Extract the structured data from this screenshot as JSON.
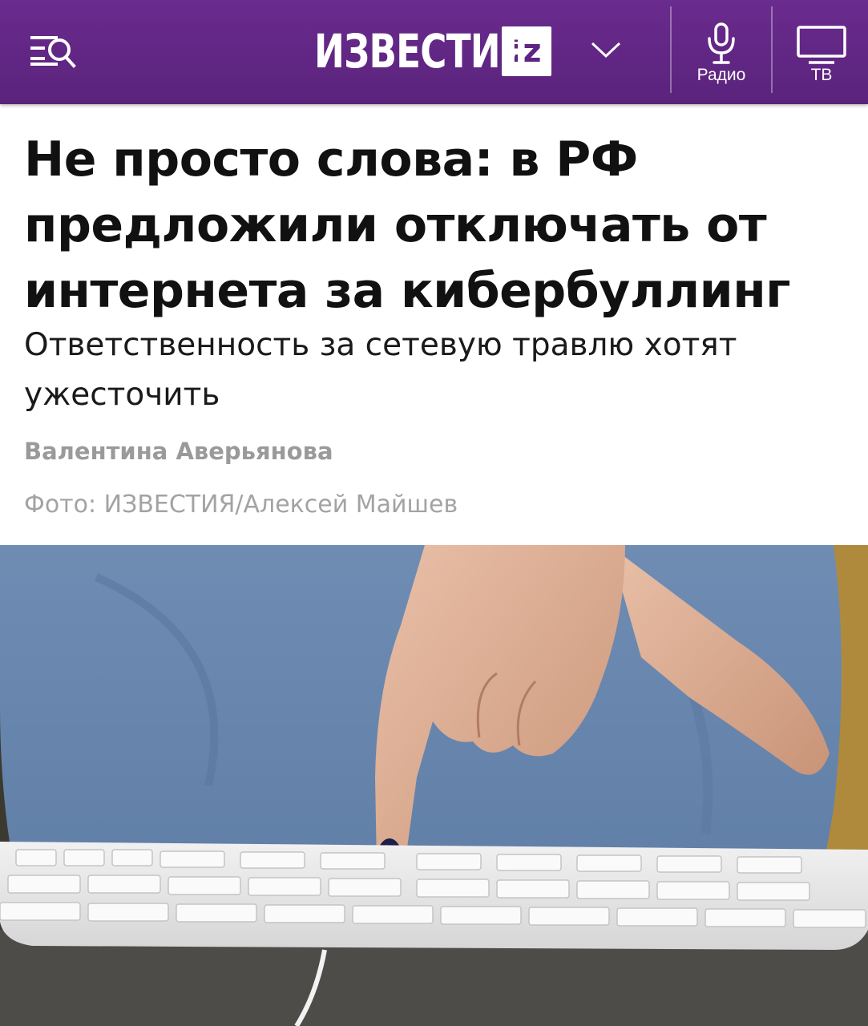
{
  "header": {
    "logo_text": "ИЗВЕСТИЯ",
    "logo_badge": "iz",
    "radio_label": "Радио",
    "tv_label": "ТВ",
    "background": "#5e2582"
  },
  "article": {
    "title": "Не просто слова: в РФ предложили отключать от интернета за кибербуллинг",
    "subtitle": "Ответственность за сетевую травлю хотят ужесточить",
    "author": "Валентина Аверьянова",
    "photo_credit": "Фото: ИЗВЕСТИЯ/Алексей Майшев"
  }
}
